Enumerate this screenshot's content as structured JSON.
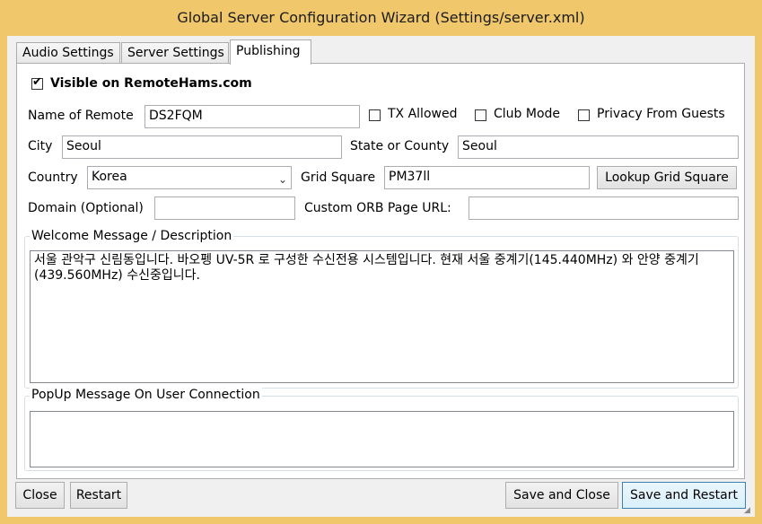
{
  "window": {
    "title": "Global Server Configuration Wizard (Settings/server.xml)"
  },
  "tabs": [
    {
      "label": "Audio Settings",
      "active": false
    },
    {
      "label": "Server Settings",
      "active": false
    },
    {
      "label": "Publishing",
      "active": true
    }
  ],
  "publishing": {
    "visible_checkbox": {
      "label": "Visible on RemoteHams.com",
      "checked": true
    },
    "name_of_remote": {
      "label": "Name of Remote",
      "value": "DS2FQM"
    },
    "tx_allowed": {
      "label": "TX Allowed",
      "checked": false
    },
    "club_mode": {
      "label": "Club Mode",
      "checked": false
    },
    "privacy_from_guests": {
      "label": "Privacy From Guests",
      "checked": false
    },
    "city": {
      "label": "City",
      "value": "Seoul"
    },
    "state_or_county": {
      "label": "State or County",
      "value": "Seoul"
    },
    "country": {
      "label": "Country",
      "value": "Korea"
    },
    "grid_square": {
      "label": "Grid Square",
      "value": "PM37ll"
    },
    "lookup_grid_square_button": "Lookup Grid Square",
    "domain": {
      "label": "Domain (Optional)",
      "value": ""
    },
    "custom_orb_page_url": {
      "label": "Custom ORB Page URL:",
      "value": ""
    },
    "welcome_message": {
      "label": "Welcome Message / Description",
      "value": "서울 관악구 신림동입니다. 바오펭 UV-5R 로 구성한 수신전용 시스템입니다. 현재 서울 중계기(145.440MHz) 와 안양 중계기(439.560MHz) 수신중입니다."
    },
    "popup_message": {
      "label": "PopUp Message On User Connection",
      "value": ""
    }
  },
  "footer": {
    "close_button": "Close",
    "restart_button": "Restart",
    "save_and_close_button": "Save and Close",
    "save_and_restart_button": "Save and Restart"
  },
  "icons": {
    "check": "✔",
    "dropdown": "chevron-down-icon",
    "resize_grip": "resize-grip-icon"
  }
}
